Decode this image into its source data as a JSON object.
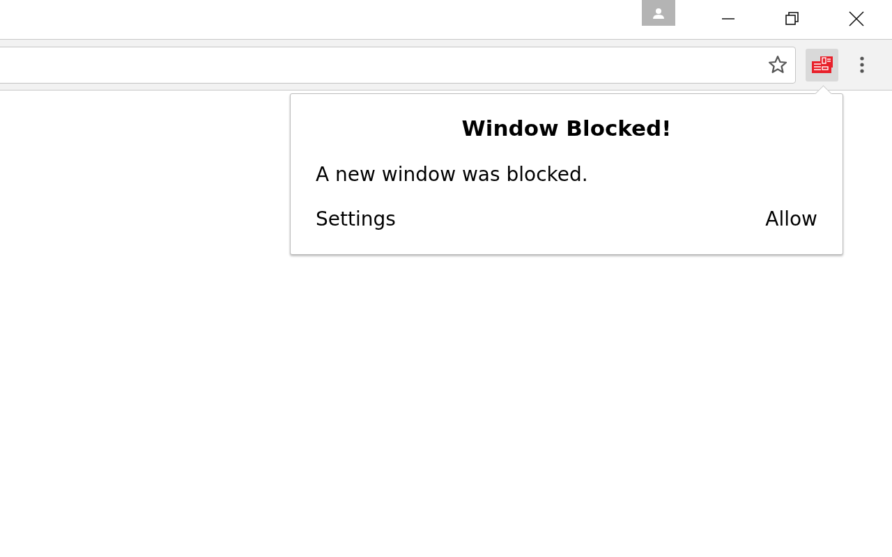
{
  "popup": {
    "title": "Window Blocked!",
    "message": "A new window was blocked.",
    "settings_link": "Settings",
    "allow_button": "Allow"
  }
}
